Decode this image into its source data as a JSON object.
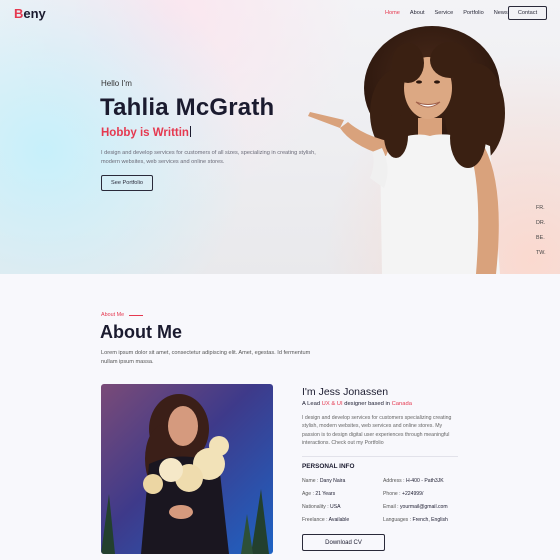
{
  "brand": {
    "first_letter": "B",
    "rest": "eny"
  },
  "nav": {
    "items": [
      "Home",
      "About",
      "Service",
      "Portfolio",
      "News"
    ],
    "active": "Home",
    "contact_label": "Contact"
  },
  "hero": {
    "greeting": "Hello I'm",
    "name": "Tahlia McGrath",
    "hobby": "Hobby is Writtin",
    "description": "I design and develop services for customers of all sizes, specializing in creating stylish, modern websites, web services and online stores.",
    "button_label": "See Portfolio"
  },
  "socials": [
    "FR.",
    "DR.",
    "BE.",
    "TW."
  ],
  "about": {
    "tag": "About Me",
    "title": "About Me",
    "description": "Lorem ipsum dolor sit amet, consectetur adipiscing elit. Amet, egestas. Id fermentum nullam ipsum massa.",
    "person_name": "I'm Jess Jonassen",
    "role_prefix": "A Lead ",
    "role_highlight": "UX & UI",
    "role_middle": " designer based in ",
    "role_location": "Canada",
    "bio": "I design and develop services for customers specializing creating stylish, modern websites, web services and online stores. My passion is to design digital user experiences through meaningful interactions. Check out my Portfolio",
    "personal_info_title": "PERSONAL INFO",
    "info": {
      "name_label": "Name : ",
      "name_value": "Dany Naira",
      "address_label": "Address : ",
      "address_value": "H-400 - Path3JK",
      "age_label": "Age : ",
      "age_value": "21 Years",
      "phone_label": "Phone : ",
      "phone_value": "+224999/",
      "nationality_label": "Nationality : ",
      "nationality_value": "USA",
      "email_label": "Email : ",
      "email_value": "yourmail@gmail.com",
      "freelance_label": "Freelance : ",
      "freelance_value": "Available",
      "languages_label": "Languages : ",
      "languages_value": "French, English"
    },
    "download_label": "Download CV"
  },
  "colors": {
    "accent": "#e53950",
    "text_dark": "#1b1b2f"
  }
}
